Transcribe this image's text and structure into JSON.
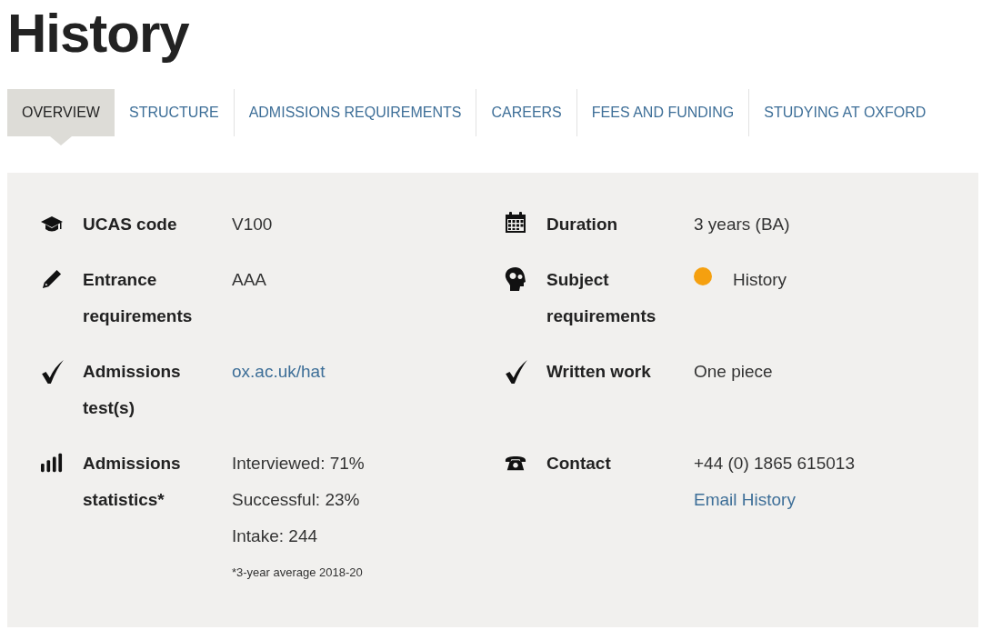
{
  "page_title": "History",
  "tabs": [
    {
      "label": "OVERVIEW",
      "selected": true
    },
    {
      "label": "STRUCTURE",
      "selected": false
    },
    {
      "label": "ADMISSIONS REQUIREMENTS",
      "selected": false
    },
    {
      "label": "CAREERS",
      "selected": false
    },
    {
      "label": "FEES AND FUNDING",
      "selected": false
    },
    {
      "label": "STUDYING AT OXFORD",
      "selected": false
    }
  ],
  "facts": [
    {
      "label": "UCAS code",
      "values": [
        {
          "kind": "text",
          "text": "V100"
        }
      ]
    },
    {
      "label": "Duration",
      "values": [
        {
          "kind": "text",
          "text": "3 years (BA)"
        }
      ]
    },
    {
      "label": "Entrance requirements",
      "values": [
        {
          "kind": "text",
          "text": "AAA"
        }
      ]
    },
    {
      "label": "Subject requirements",
      "values": [
        {
          "kind": "dot",
          "text": "History",
          "color": "#f5a00f"
        }
      ]
    },
    {
      "label": "Admissions test(s)",
      "values": [
        {
          "kind": "link",
          "text": "ox.ac.uk/hat"
        }
      ]
    },
    {
      "label": "Written work",
      "values": [
        {
          "kind": "text",
          "text": "One piece"
        }
      ]
    },
    {
      "label": "Admissions statistics*",
      "values": [
        {
          "kind": "text",
          "text": "Interviewed: 71%"
        },
        {
          "kind": "text",
          "text": "Successful: 23%"
        },
        {
          "kind": "text",
          "text": "Intake: 244"
        },
        {
          "kind": "note",
          "text": "*3-year average 2018-20"
        }
      ]
    },
    {
      "label": "Contact",
      "values": [
        {
          "kind": "text",
          "text": "+44 (0) 1865 615013"
        },
        {
          "kind": "link",
          "text": "Email History"
        }
      ]
    }
  ]
}
